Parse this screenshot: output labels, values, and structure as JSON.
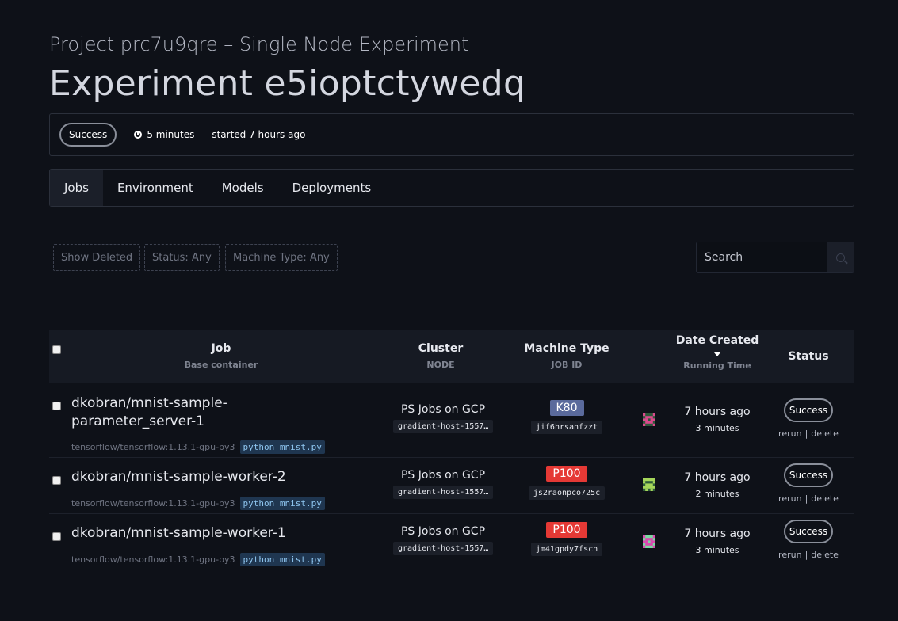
{
  "header": {
    "project_title": "Project prc7u9qre – Single Node Experiment",
    "experiment_title": "Experiment e5ioptctywedq"
  },
  "summary": {
    "status": "Success",
    "duration": "5 minutes",
    "started": "started 7 hours ago"
  },
  "tabs": [
    {
      "label": "Jobs",
      "active": true
    },
    {
      "label": "Environment",
      "active": false
    },
    {
      "label": "Models",
      "active": false
    },
    {
      "label": "Deployments",
      "active": false
    }
  ],
  "filters": {
    "show_deleted": "Show Deleted",
    "status": "Status: Any",
    "machine_type": "Machine Type: Any"
  },
  "search": {
    "placeholder": "Search"
  },
  "table": {
    "columns": {
      "job": "Job",
      "job_sub": "Base container",
      "cluster": "Cluster",
      "cluster_sub": "NODE",
      "machine": "Machine Type",
      "machine_sub": "JOB ID",
      "date": "Date Created",
      "date_sub": "Running Time",
      "status": "Status"
    },
    "rows": [
      {
        "name": "dkobran/mnist-sample-parameter_server-1",
        "container": "tensorflow/tensorflow:1.13.1-gpu-py3",
        "command": "python mnist.py",
        "cluster": "PS Jobs on GCP",
        "node": "gradient-host-1557…",
        "machine": "K80",
        "machine_color": "#5a6a9c",
        "job_id": "jif6hrsanfzzt",
        "date": "7 hours ago",
        "running": "3 minutes",
        "status": "Success",
        "rerun": "rerun",
        "delete": "delete"
      },
      {
        "name": "dkobran/mnist-sample-worker-2",
        "container": "tensorflow/tensorflow:1.13.1-gpu-py3",
        "command": "python mnist.py",
        "cluster": "PS Jobs on GCP",
        "node": "gradient-host-1557…",
        "machine": "P100",
        "machine_color": "#e53935",
        "job_id": "js2raonpco725c",
        "date": "7 hours ago",
        "running": "2 minutes",
        "status": "Success",
        "rerun": "rerun",
        "delete": "delete"
      },
      {
        "name": "dkobran/mnist-sample-worker-1",
        "container": "tensorflow/tensorflow:1.13.1-gpu-py3",
        "command": "python mnist.py",
        "cluster": "PS Jobs on GCP",
        "node": "gradient-host-1557…",
        "machine": "P100",
        "machine_color": "#e53935",
        "job_id": "jm41gpdy7fscn",
        "date": "7 hours ago",
        "running": "3 minutes",
        "status": "Success",
        "rerun": "rerun",
        "delete": "delete"
      }
    ]
  }
}
